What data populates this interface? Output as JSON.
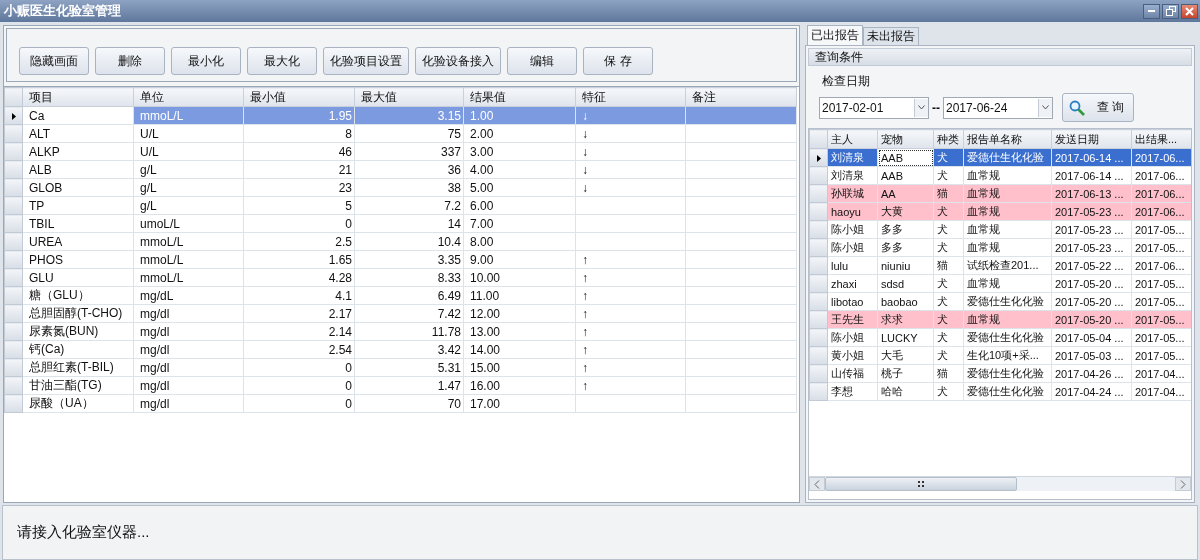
{
  "window": {
    "title": "小赈医生化验室管理"
  },
  "toolbar": {
    "buttons": [
      "隐藏画面",
      "删除",
      "最小化",
      "最大化",
      "化验项目设置",
      "化验设备接入",
      "编辑",
      "保 存"
    ]
  },
  "items_table": {
    "columns": [
      "项目",
      "单位",
      "最小值",
      "最大值",
      "结果值",
      "特征",
      "备注"
    ],
    "rows": [
      {
        "cells": [
          "Ca",
          "mmoL/L",
          "1.95",
          "3.15",
          "1.00",
          "↓",
          ""
        ],
        "selected": true
      },
      {
        "cells": [
          "ALT",
          "U/L",
          "8",
          "75",
          "2.00",
          "↓",
          ""
        ],
        "selected": false
      },
      {
        "cells": [
          "ALKP",
          "U/L",
          "46",
          "337",
          "3.00",
          "↓",
          ""
        ],
        "selected": false
      },
      {
        "cells": [
          "ALB",
          "g/L",
          "21",
          "36",
          "4.00",
          "↓",
          ""
        ],
        "selected": false
      },
      {
        "cells": [
          "GLOB",
          "g/L",
          "23",
          "38",
          "5.00",
          "↓",
          ""
        ],
        "selected": false
      },
      {
        "cells": [
          "TP",
          "g/L",
          "5",
          "7.2",
          "6.00",
          "",
          ""
        ],
        "selected": false
      },
      {
        "cells": [
          "TBIL",
          "umoL/L",
          "0",
          "14",
          "7.00",
          "",
          ""
        ],
        "selected": false
      },
      {
        "cells": [
          "UREA",
          "mmoL/L",
          "2.5",
          "10.4",
          "8.00",
          "",
          ""
        ],
        "selected": false
      },
      {
        "cells": [
          "PHOS",
          "mmoL/L",
          "1.65",
          "3.35",
          "9.00",
          "↑",
          ""
        ],
        "selected": false
      },
      {
        "cells": [
          "GLU",
          "mmoL/L",
          "4.28",
          "8.33",
          "10.00",
          "↑",
          ""
        ],
        "selected": false
      },
      {
        "cells": [
          "糖（GLU）",
          "mg/dL",
          "4.1",
          "6.49",
          "11.00",
          "↑",
          ""
        ],
        "selected": false
      },
      {
        "cells": [
          "总胆固醇(T-CHO)",
          "mg/dl",
          "2.17",
          "7.42",
          "12.00",
          "↑",
          ""
        ],
        "selected": false
      },
      {
        "cells": [
          "尿素氮(BUN)",
          "mg/dl",
          "2.14",
          "11.78",
          "13.00",
          "↑",
          ""
        ],
        "selected": false
      },
      {
        "cells": [
          "钙(Ca)",
          "mg/dl",
          "2.54",
          "3.42",
          "14.00",
          "↑",
          ""
        ],
        "selected": false
      },
      {
        "cells": [
          "总胆红素(T-BIL)",
          "mg/dl",
          "0",
          "5.31",
          "15.00",
          "↑",
          ""
        ],
        "selected": false
      },
      {
        "cells": [
          "甘油三酯(TG)",
          "mg/dl",
          "0",
          "1.47",
          "16.00",
          "↑",
          ""
        ],
        "selected": false
      },
      {
        "cells": [
          "尿酸（UA）",
          "mg/dl",
          "0",
          "70",
          "17.00",
          "",
          ""
        ],
        "selected": false
      }
    ]
  },
  "report_tabs": [
    {
      "label": "已出报告",
      "selected": true
    },
    {
      "label": "未出报告",
      "selected": false
    }
  ],
  "query": {
    "title": "查询条件",
    "date_label": "检查日期",
    "date_from": "2017-02-01",
    "separator": "--",
    "date_to": "2017-06-24",
    "button": "查 询"
  },
  "reports_table": {
    "columns": [
      "主人",
      "宠物",
      "种类",
      "报告单名称",
      "发送日期",
      "出结果..."
    ],
    "rows": [
      {
        "cells": [
          "刘清泉",
          "AAB",
          "犬",
          "爱德仕生化化验",
          "2017-06-14 ...",
          "2017-06..."
        ],
        "selected": true,
        "color": "#ffffff"
      },
      {
        "cells": [
          "刘清泉",
          "AAB",
          "犬",
          "血常规",
          "2017-06-14 ...",
          "2017-06..."
        ],
        "selected": false,
        "color": "#ffffff"
      },
      {
        "cells": [
          "孙联城",
          "AA",
          "猫",
          "血常规",
          "2017-06-13 ...",
          "2017-06..."
        ],
        "selected": false,
        "color": "#ffc0cb"
      },
      {
        "cells": [
          "haoyu",
          "大黄",
          "犬",
          "血常规",
          "2017-05-23 ...",
          "2017-06..."
        ],
        "selected": false,
        "color": "#ffc0cb"
      },
      {
        "cells": [
          "陈小姐",
          "多多",
          "犬",
          "血常规",
          "2017-05-23 ...",
          "2017-05..."
        ],
        "selected": false,
        "color": "#ffffff"
      },
      {
        "cells": [
          "陈小姐",
          "多多",
          "犬",
          "血常规",
          "2017-05-23 ...",
          "2017-05..."
        ],
        "selected": false,
        "color": "#ffffff"
      },
      {
        "cells": [
          "lulu",
          "niuniu",
          "猫",
          "试纸检查201...",
          "2017-05-22 ...",
          "2017-06..."
        ],
        "selected": false,
        "color": "#ffffff"
      },
      {
        "cells": [
          "zhaxi",
          "sdsd",
          "犬",
          "血常规",
          "2017-05-20 ...",
          "2017-05..."
        ],
        "selected": false,
        "color": "#ffffff"
      },
      {
        "cells": [
          "libotao",
          "baobao",
          "犬",
          "爱德仕生化化验",
          "2017-05-20 ...",
          "2017-05..."
        ],
        "selected": false,
        "color": "#ffffff"
      },
      {
        "cells": [
          "王先生",
          "求求",
          "犬",
          "血常规",
          "2017-05-20 ...",
          "2017-05..."
        ],
        "selected": false,
        "color": "#ffc0cb"
      },
      {
        "cells": [
          "陈小姐",
          "LUCKY",
          "犬",
          "爱德仕生化化验",
          "2017-05-04 ...",
          "2017-05..."
        ],
        "selected": false,
        "color": "#ffffff"
      },
      {
        "cells": [
          "黄小姐",
          "大毛",
          "犬",
          "生化10项+采...",
          "2017-05-03 ...",
          "2017-05..."
        ],
        "selected": false,
        "color": "#ffffff"
      },
      {
        "cells": [
          "山传福",
          "桃子",
          "猫",
          "爱德仕生化化验",
          "2017-04-26 ...",
          "2017-04..."
        ],
        "selected": false,
        "color": "#ffffff"
      },
      {
        "cells": [
          "李想",
          "哈哈",
          "犬",
          "爱德仕生化化验",
          "2017-04-24 ...",
          "2017-04..."
        ],
        "selected": false,
        "color": "#ffffff"
      }
    ]
  },
  "status_bar": {
    "message": "请接入化验室仪器..."
  }
}
